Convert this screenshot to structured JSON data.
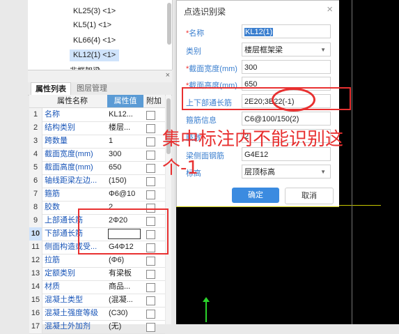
{
  "tree": {
    "items": [
      "KL25(3) <1>",
      "KL5(1) <1>",
      "KL66(4) <1>",
      "KL12(1) <1>"
    ],
    "selected_index": 3,
    "cut_item": "非框架梁"
  },
  "prop_panel": {
    "close": "×",
    "tabs": [
      "属性列表",
      "图层管理"
    ],
    "header": {
      "name": "属性名称",
      "value": "属性值",
      "extra": "附加"
    },
    "rows": [
      {
        "num": "1",
        "name": "名称",
        "value": "KL12..."
      },
      {
        "num": "2",
        "name": "结构类别",
        "value": "楼层..."
      },
      {
        "num": "3",
        "name": "跨数量",
        "value": "1"
      },
      {
        "num": "4",
        "name": "截面宽度(mm)",
        "value": "300"
      },
      {
        "num": "5",
        "name": "截面高度(mm)",
        "value": "650"
      },
      {
        "num": "6",
        "name": "轴线距梁左边...",
        "value": "(150)"
      },
      {
        "num": "7",
        "name": "箍筋",
        "value": "Φ6@10"
      },
      {
        "num": "8",
        "name": "胶数",
        "value": "2"
      },
      {
        "num": "9",
        "name": "上部通长筋",
        "value": "2Φ20"
      },
      {
        "num": "10",
        "name": "下部通长筋",
        "value": ""
      },
      {
        "num": "11",
        "name": "侧面构造或受...",
        "value": "G4Φ12"
      },
      {
        "num": "12",
        "name": "拉筋",
        "value": "(Φ6)"
      },
      {
        "num": "13",
        "name": "定额类别",
        "value": "有梁板"
      },
      {
        "num": "14",
        "name": "材质",
        "value": "商品..."
      },
      {
        "num": "15",
        "name": "混凝土类型",
        "value": "(混凝..."
      },
      {
        "num": "16",
        "name": "混凝土强度等级",
        "value": "(C30)"
      },
      {
        "num": "17",
        "name": "混凝土外加剂",
        "value": "(无)"
      }
    ]
  },
  "dialog": {
    "title": "点选识别梁",
    "close": "×",
    "fields": [
      {
        "label": "名称",
        "required": true,
        "value": "KL12(1)"
      },
      {
        "label": "类别",
        "required": false,
        "value": "楼层框架梁"
      },
      {
        "label": "截面宽度(mm)",
        "required": true,
        "value": "300"
      },
      {
        "label": "截面高度(mm)",
        "required": true,
        "value": "650"
      },
      {
        "label": "上下部通长筋",
        "required": false,
        "value": "2E20;3E22(-1)"
      },
      {
        "label": "箍筋信息",
        "required": false,
        "value": "C6@100/150(2)"
      },
      {
        "label": "肢数",
        "required": false,
        "value": "2"
      },
      {
        "label": "梁侧面钢筋",
        "required": false,
        "value": "G4E12"
      },
      {
        "label": "标高",
        "required": false,
        "value": "层顶标高"
      }
    ],
    "ok": "确定",
    "cancel": "取消"
  },
  "annotation": {
    "line1": "集中标注内不能识别这",
    "line2": "个-1"
  },
  "colors": {
    "accent": "#3b8be0",
    "annotation": "#e83030"
  }
}
